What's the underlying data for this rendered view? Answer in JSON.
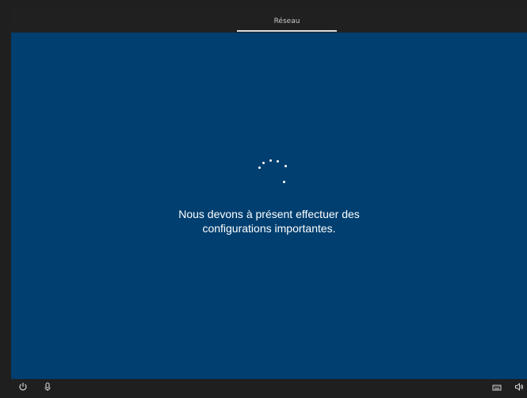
{
  "header": {
    "tab_label": "Réseau"
  },
  "main": {
    "message_line1": "Nous devons à présent effectuer des",
    "message_line2": "configurations importantes."
  },
  "icons": {
    "ease_of_access": "ease-of-access-icon",
    "microphone": "microphone-icon",
    "keyboard": "keyboard-icon",
    "volume": "volume-icon"
  },
  "colors": {
    "background": "#003f70",
    "topbar": "#202020",
    "text": "#ffffff",
    "accent": "#dcdcdc"
  }
}
